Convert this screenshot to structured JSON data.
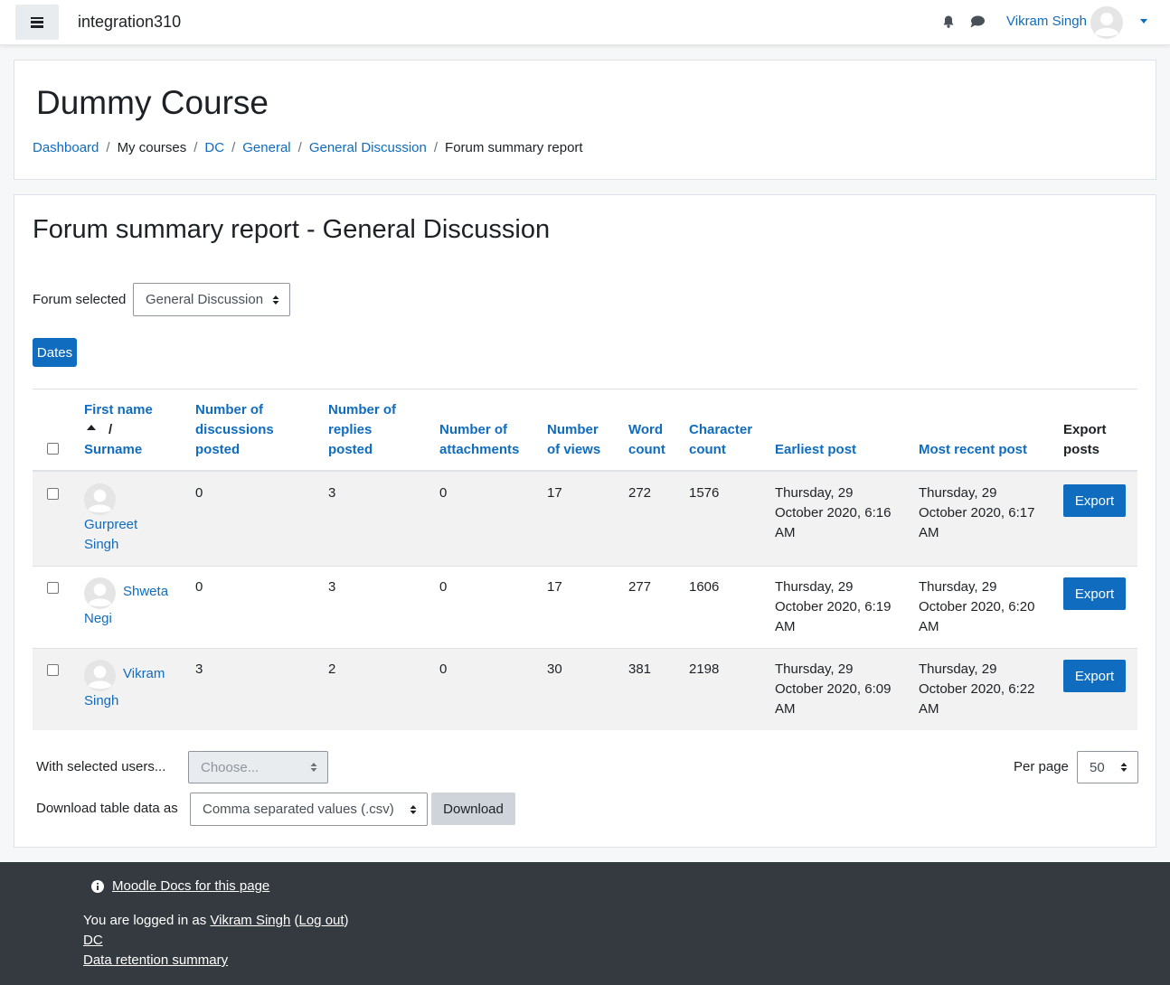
{
  "navbar": {
    "site_name": "integration310",
    "user_name": "Vikram Singh",
    "icons": [
      "menu-icon",
      "bell-icon",
      "chat-icon",
      "user-avatar",
      "caret-down-icon"
    ]
  },
  "header": {
    "course_title": "Dummy Course",
    "breadcrumb": [
      {
        "label": "Dashboard",
        "link": true
      },
      {
        "label": "My courses",
        "link": false
      },
      {
        "label": "DC",
        "link": true
      },
      {
        "label": "General",
        "link": true
      },
      {
        "label": "General Discussion",
        "link": true
      },
      {
        "label": "Forum summary report",
        "link": false
      }
    ],
    "separator": "/"
  },
  "report": {
    "title": "Forum summary report - General Discussion",
    "forum_label": "Forum selected",
    "forum_value": "General Discussion",
    "dates_button": "Dates"
  },
  "table": {
    "headers": {
      "first_name": "First name",
      "sort_sep": "/",
      "surname": "Surname",
      "discussions": [
        "Number of",
        "discussions",
        "posted"
      ],
      "replies": [
        "Number of",
        "replies",
        "posted"
      ],
      "attachments": [
        "Number of",
        "attachments"
      ],
      "views": [
        "Number",
        "of views"
      ],
      "words": [
        "Word",
        "count"
      ],
      "chars": [
        "Character",
        "count"
      ],
      "earliest": "Earliest post",
      "recent": "Most recent post",
      "export": [
        "Export",
        "posts"
      ]
    },
    "rows": [
      {
        "name_line1": "Gurpreet",
        "name_line2": "Singh",
        "discussions": "0",
        "replies": "3",
        "attachments": "0",
        "views": "17",
        "words": "272",
        "chars": "1576",
        "earliest": "Thursday, 29 October 2020, 6:16 AM",
        "recent": "Thursday, 29 October 2020, 6:17 AM",
        "export": "Export"
      },
      {
        "name_line1": "Shweta",
        "name_line2": "Negi",
        "discussions": "0",
        "replies": "3",
        "attachments": "0",
        "views": "17",
        "words": "277",
        "chars": "1606",
        "earliest": "Thursday, 29 October 2020, 6:19 AM",
        "recent": "Thursday, 29 October 2020, 6:20 AM",
        "export": "Export"
      },
      {
        "name_line1": "Vikram",
        "name_line2": "Singh",
        "discussions": "3",
        "replies": "2",
        "attachments": "0",
        "views": "30",
        "words": "381",
        "chars": "2198",
        "earliest": "Thursday, 29 October 2020, 6:09 AM",
        "recent": "Thursday, 29 October 2020, 6:22 AM",
        "export": "Export"
      }
    ]
  },
  "bulk": {
    "with_selected_label": "With selected users...",
    "choose_placeholder": "Choose...",
    "per_page_label": "Per page",
    "per_page_value": "50",
    "download_label": "Download table data as",
    "download_format": "Comma separated values (.csv)",
    "download_button": "Download"
  },
  "footer": {
    "docs_link": "Moodle Docs for this page",
    "logged_in_prefix": "You are logged in as ",
    "logged_in_user": "Vikram Singh",
    "logout_open": " (",
    "logout_label": "Log out",
    "logout_close": ")",
    "course_link": "DC",
    "retention_link": "Data retention summary"
  }
}
